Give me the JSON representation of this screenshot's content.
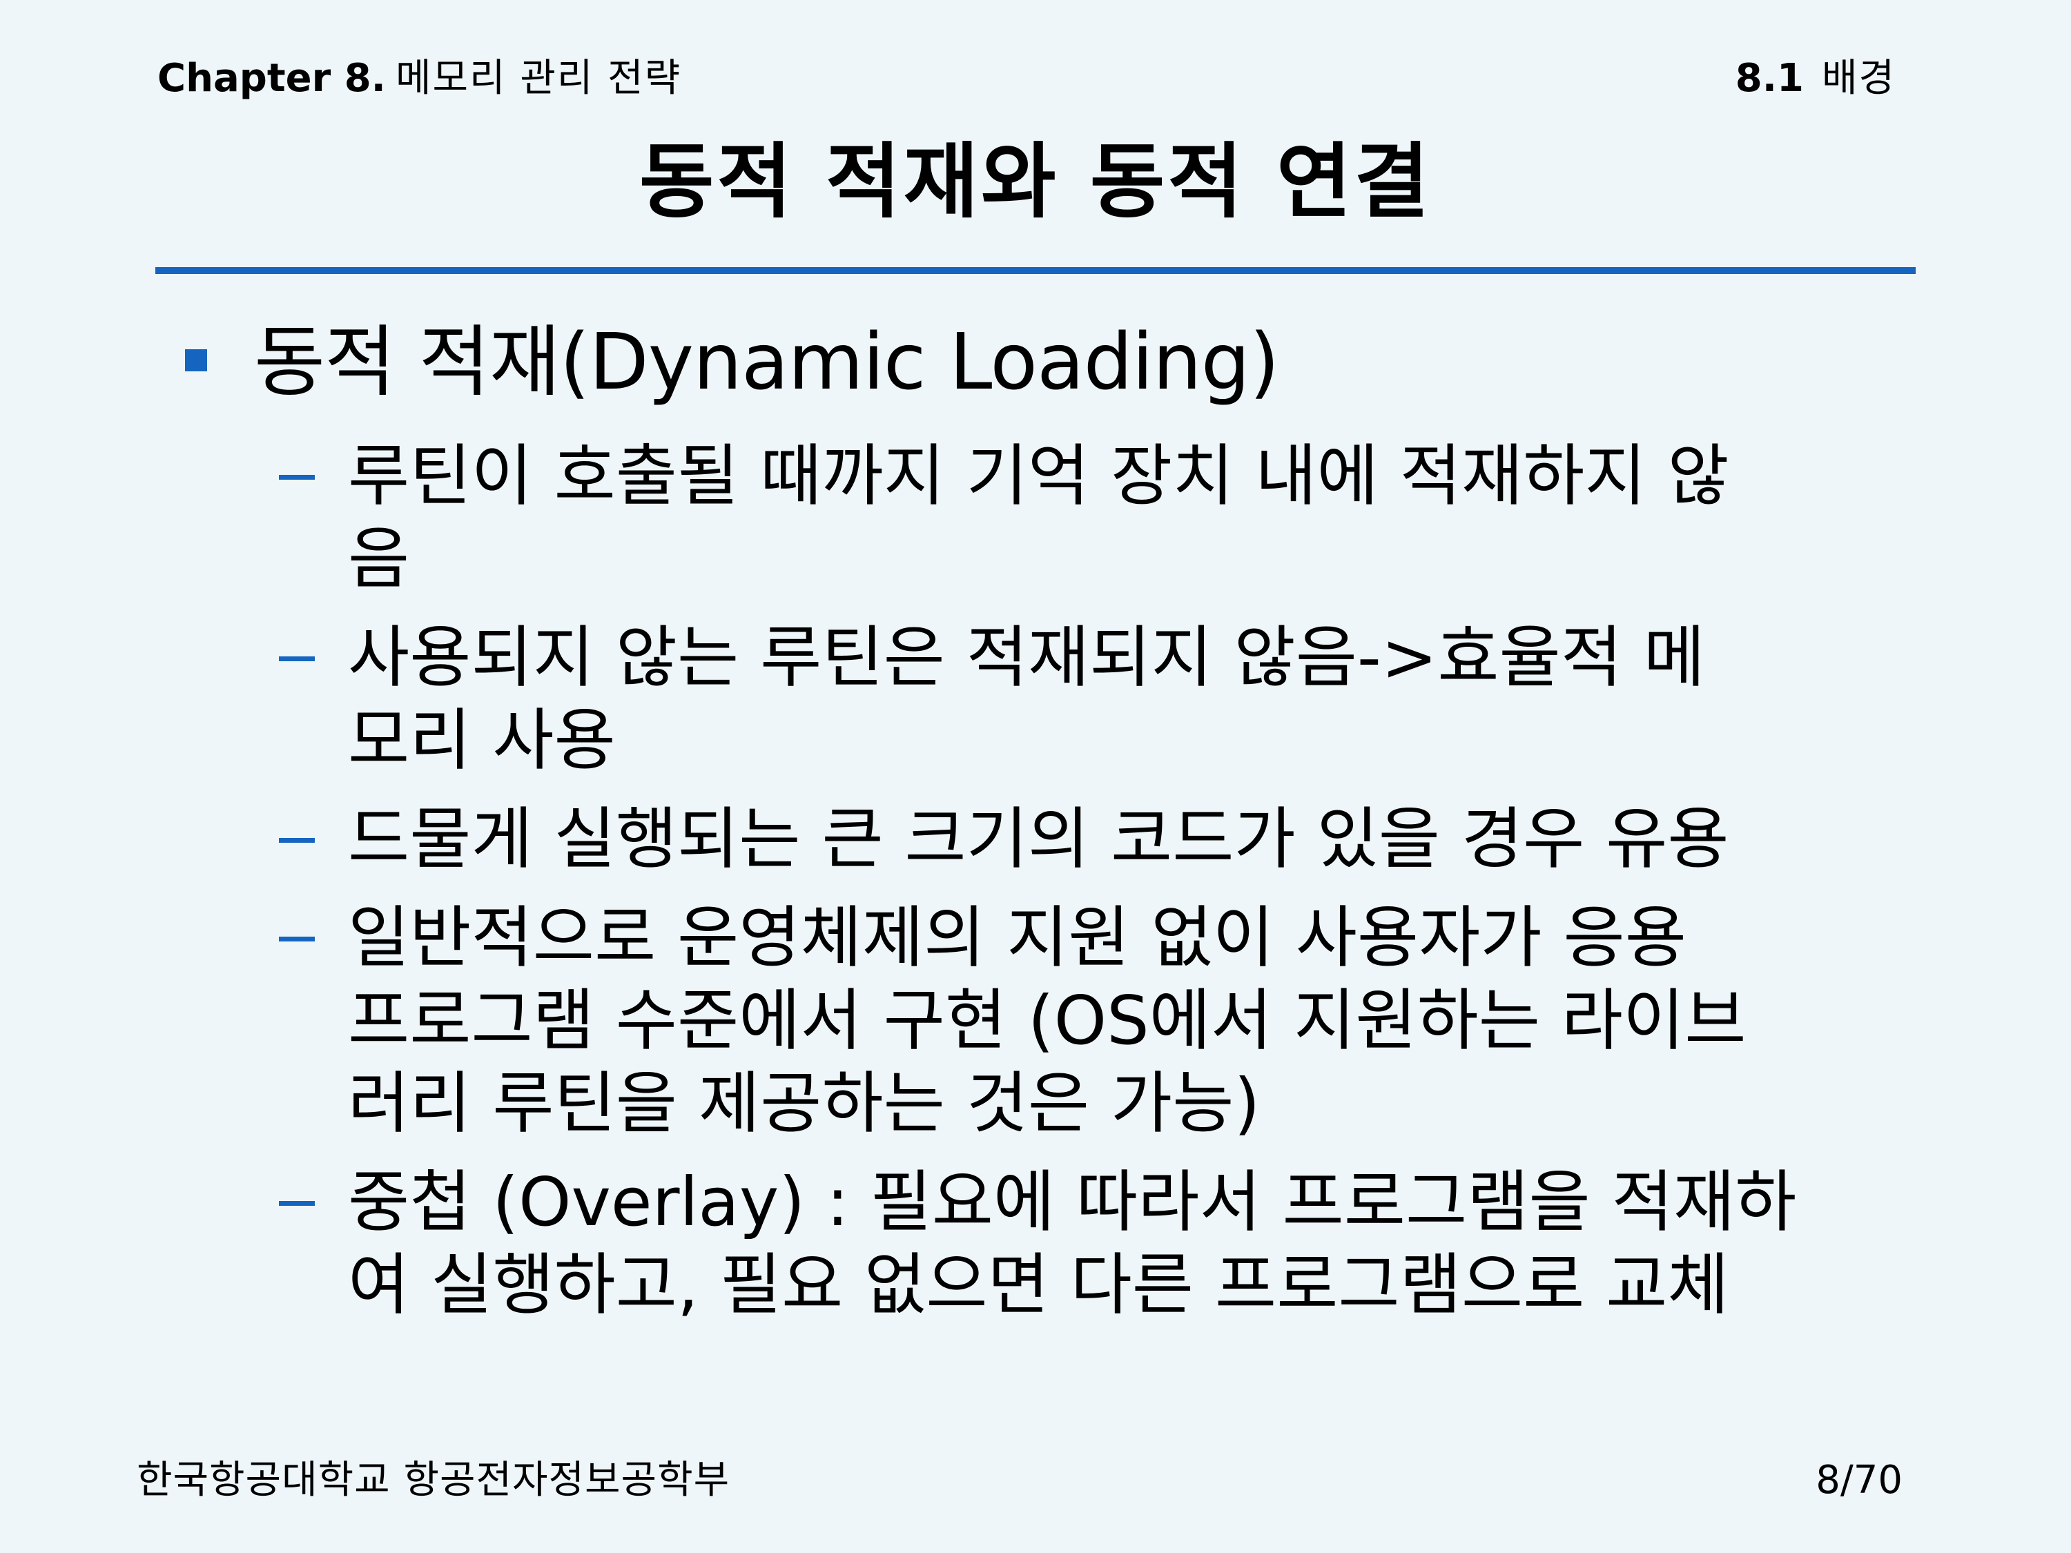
{
  "header": {
    "chapter_num": "Chapter 8.",
    "chapter_title": "메모리 관리 전략",
    "section_num": "8.1",
    "section_title": "배경"
  },
  "title": "동적 적재와 동적 연결",
  "bullet": {
    "text": "동적 적재(Dynamic Loading)",
    "items": [
      {
        "lines": [
          "루틴이 호출될 때까지 기억 장치 내에 적재하지 않",
          "음"
        ]
      },
      {
        "lines": [
          "사용되지 않는 루틴은 적재되지 않음->효율적 메",
          "모리 사용"
        ]
      },
      {
        "lines": [
          "드물게 실행되는 큰 크기의 코드가 있을 경우 유용"
        ]
      },
      {
        "lines": [
          "일반적으로 운영체제의 지원 없이 사용자가 응용",
          "프로그램 수준에서 구현 (OS에서 지원하는 라이브",
          "러리 루틴을 제공하는 것은 가능)"
        ]
      },
      {
        "lines": [
          "중첩 (Overlay) : 필요에 따라서 프로그램을 적재하",
          "여 실행하고, 필요 없으면 다른 프로그램으로 교체"
        ]
      }
    ]
  },
  "footer": {
    "university": "한국항공대학교 항공전자정보공학부",
    "page": "8/70"
  },
  "colors": {
    "accent": "#1565c0",
    "background": "#eef6f9"
  }
}
